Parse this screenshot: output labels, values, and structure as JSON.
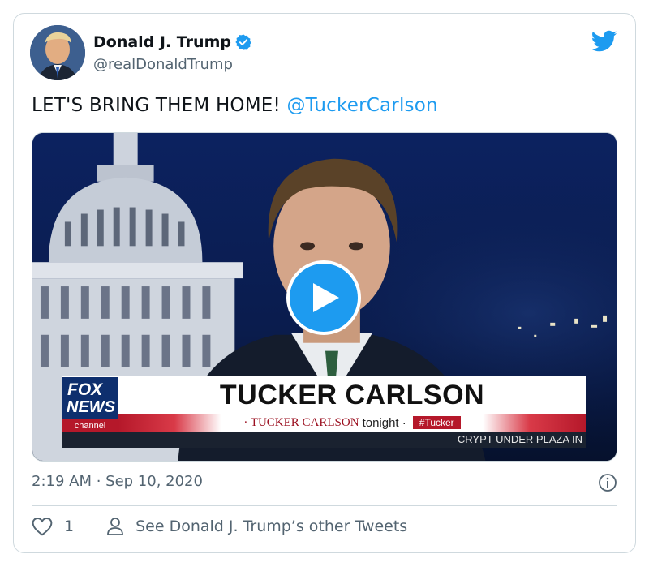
{
  "author": {
    "display_name": "Donald J. Trump",
    "handle": "@realDonaldTrump",
    "verified": true
  },
  "tweet": {
    "text": "LET'S BRING THEM HOME! ",
    "mention": "@TuckerCarlson"
  },
  "media": {
    "lower_third": {
      "logo_fox": "FOX",
      "logo_news": "NEWS",
      "logo_channel": "channel",
      "name": "TUCKER CARLSON",
      "show_prefix": "· TUCKER CARLSON",
      "show_suffix": "tonight ·",
      "hashtag": "#Tucker",
      "ticker": "CRYPT UNDER PLAZA IN"
    }
  },
  "timestamp": "2:19 AM · Sep 10, 2020",
  "actions": {
    "like_count": "1",
    "other_tweets_label": "See Donald J. Trump’s other Tweets"
  },
  "icons": {
    "brand": "twitter-bird-icon",
    "verified": "verified-badge-icon",
    "play": "play-icon",
    "info": "info-icon",
    "like": "heart-icon",
    "profile": "person-icon"
  },
  "colors": {
    "accent": "#1d9bf0",
    "secondary_text": "#536471",
    "border": "#cfd9de"
  }
}
